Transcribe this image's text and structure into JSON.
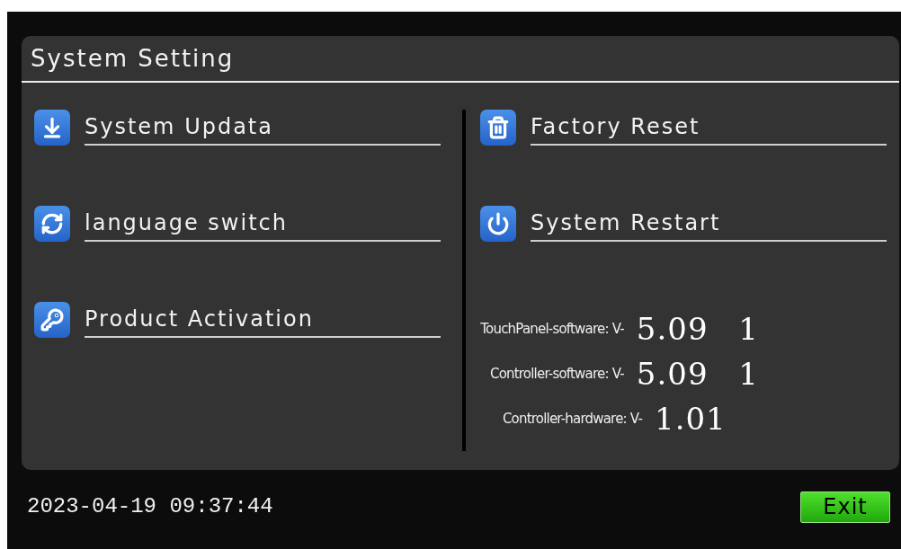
{
  "panel": {
    "title": "System Setting",
    "left_items": [
      {
        "label": "System Updata"
      },
      {
        "label": "language switch"
      },
      {
        "label": "Product Activation"
      }
    ],
    "right_items": [
      {
        "label": "Factory Reset"
      },
      {
        "label": "System Restart"
      }
    ],
    "versions": [
      {
        "label": "TouchPanel-software: V-",
        "value": "5.09 1"
      },
      {
        "label": "Controller-software: V-",
        "value": "5.09 1"
      },
      {
        "label": "Controller-hardware: V-",
        "value": "1.01"
      }
    ]
  },
  "status_bar": {
    "datetime": "2023-04-19 09:37:44",
    "exit_button": "Exit"
  }
}
